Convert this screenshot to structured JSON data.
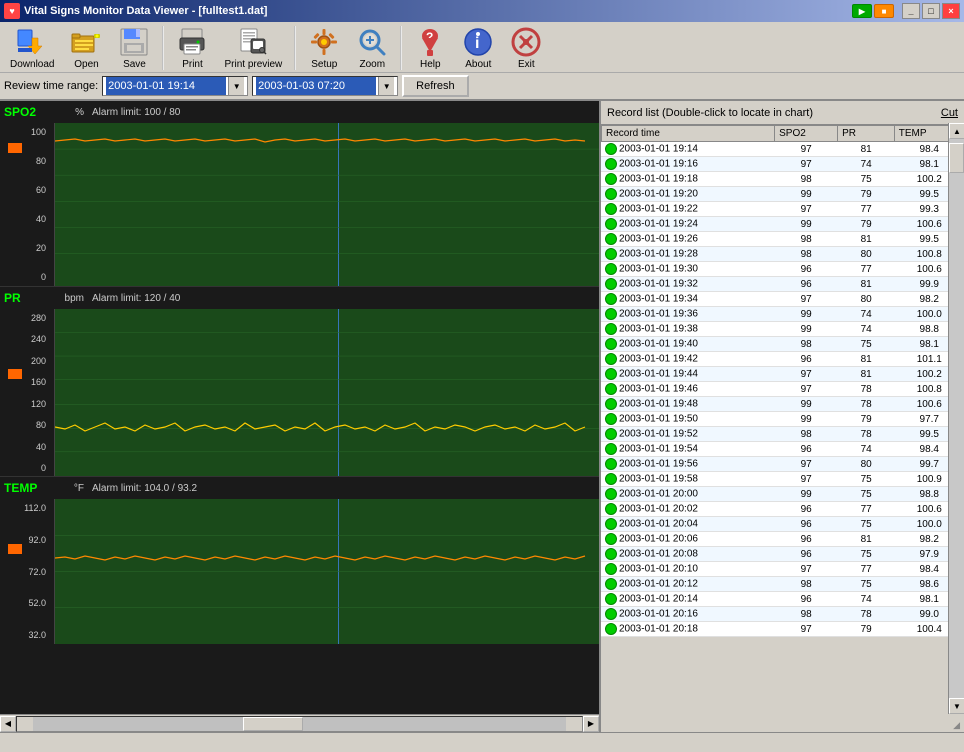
{
  "window": {
    "title": "Vital Signs Monitor Data Viewer - [fulltest1.dat]",
    "icon": "♥"
  },
  "toolbar": {
    "buttons": [
      {
        "id": "download",
        "label": "Download",
        "icon": "⬇"
      },
      {
        "id": "open",
        "label": "Open",
        "icon": "📁"
      },
      {
        "id": "save",
        "label": "Save",
        "icon": "💾"
      },
      {
        "id": "print",
        "label": "Print",
        "icon": "🖨"
      },
      {
        "id": "print-preview",
        "label": "Print preview",
        "icon": "🖨"
      },
      {
        "id": "setup",
        "label": "Setup",
        "icon": "🔧"
      },
      {
        "id": "zoom",
        "label": "Zoom",
        "icon": "🔍"
      },
      {
        "id": "help",
        "label": "Help",
        "icon": "❓"
      },
      {
        "id": "about",
        "label": "About",
        "icon": "ℹ"
      },
      {
        "id": "exit",
        "label": "Exit",
        "icon": "⏻"
      }
    ]
  },
  "review": {
    "label": "Review time range:",
    "start": "2003-01-01 19:14",
    "end": "2003-01-03 07:20",
    "refresh_label": "Refresh"
  },
  "charts": {
    "spo2": {
      "label": "SPO2",
      "unit": "%",
      "alarm": "Alarm limit:  100 / 80",
      "y_ticks": [
        "100",
        "80",
        "60",
        "40",
        "20",
        "0"
      ],
      "color": "#ff8800"
    },
    "pr": {
      "label": "PR",
      "unit": "bpm",
      "alarm": "Alarm limit:  120 / 40",
      "y_ticks": [
        "280",
        "240",
        "200",
        "160",
        "120",
        "80",
        "40",
        "0"
      ],
      "color": "#ffcc00"
    },
    "temp": {
      "label": "TEMP",
      "unit": "°F",
      "alarm": "Alarm limit:  104.0 / 93.2",
      "y_ticks": [
        "112.0",
        "92.0",
        "72.0",
        "52.0",
        "32.0"
      ],
      "color": "#ff8800"
    }
  },
  "record_list": {
    "title": "Record list (Double-click to locate in chart)",
    "cut_label": "Cut",
    "columns": [
      "Record time",
      "SPO2",
      "PR",
      "TEMP"
    ],
    "rows": [
      {
        "time": "2003-01-01 19:14",
        "spo2": "97",
        "pr": "81",
        "temp": "98.4"
      },
      {
        "time": "2003-01-01 19:16",
        "spo2": "97",
        "pr": "74",
        "temp": "98.1"
      },
      {
        "time": "2003-01-01 19:18",
        "spo2": "98",
        "pr": "75",
        "temp": "100.2"
      },
      {
        "time": "2003-01-01 19:20",
        "spo2": "99",
        "pr": "79",
        "temp": "99.5"
      },
      {
        "time": "2003-01-01 19:22",
        "spo2": "97",
        "pr": "77",
        "temp": "99.3"
      },
      {
        "time": "2003-01-01 19:24",
        "spo2": "99",
        "pr": "79",
        "temp": "100.6"
      },
      {
        "time": "2003-01-01 19:26",
        "spo2": "98",
        "pr": "81",
        "temp": "99.5"
      },
      {
        "time": "2003-01-01 19:28",
        "spo2": "98",
        "pr": "80",
        "temp": "100.8"
      },
      {
        "time": "2003-01-01 19:30",
        "spo2": "96",
        "pr": "77",
        "temp": "100.6"
      },
      {
        "time": "2003-01-01 19:32",
        "spo2": "96",
        "pr": "81",
        "temp": "99.9"
      },
      {
        "time": "2003-01-01 19:34",
        "spo2": "97",
        "pr": "80",
        "temp": "98.2"
      },
      {
        "time": "2003-01-01 19:36",
        "spo2": "99",
        "pr": "74",
        "temp": "100.0"
      },
      {
        "time": "2003-01-01 19:38",
        "spo2": "99",
        "pr": "74",
        "temp": "98.8"
      },
      {
        "time": "2003-01-01 19:40",
        "spo2": "98",
        "pr": "75",
        "temp": "98.1"
      },
      {
        "time": "2003-01-01 19:42",
        "spo2": "96",
        "pr": "81",
        "temp": "101.1"
      },
      {
        "time": "2003-01-01 19:44",
        "spo2": "97",
        "pr": "81",
        "temp": "100.2"
      },
      {
        "time": "2003-01-01 19:46",
        "spo2": "97",
        "pr": "78",
        "temp": "100.8"
      },
      {
        "time": "2003-01-01 19:48",
        "spo2": "99",
        "pr": "78",
        "temp": "100.6"
      },
      {
        "time": "2003-01-01 19:50",
        "spo2": "99",
        "pr": "79",
        "temp": "97.7"
      },
      {
        "time": "2003-01-01 19:52",
        "spo2": "98",
        "pr": "78",
        "temp": "99.5"
      },
      {
        "time": "2003-01-01 19:54",
        "spo2": "96",
        "pr": "74",
        "temp": "98.4"
      },
      {
        "time": "2003-01-01 19:56",
        "spo2": "97",
        "pr": "80",
        "temp": "99.7"
      },
      {
        "time": "2003-01-01 19:58",
        "spo2": "97",
        "pr": "75",
        "temp": "100.9"
      },
      {
        "time": "2003-01-01 20:00",
        "spo2": "99",
        "pr": "75",
        "temp": "98.8"
      },
      {
        "time": "2003-01-01 20:02",
        "spo2": "96",
        "pr": "77",
        "temp": "100.6"
      },
      {
        "time": "2003-01-01 20:04",
        "spo2": "96",
        "pr": "75",
        "temp": "100.0"
      },
      {
        "time": "2003-01-01 20:06",
        "spo2": "96",
        "pr": "81",
        "temp": "98.2"
      },
      {
        "time": "2003-01-01 20:08",
        "spo2": "96",
        "pr": "75",
        "temp": "97.9"
      },
      {
        "time": "2003-01-01 20:10",
        "spo2": "97",
        "pr": "77",
        "temp": "98.4"
      },
      {
        "time": "2003-01-01 20:12",
        "spo2": "98",
        "pr": "75",
        "temp": "98.6"
      },
      {
        "time": "2003-01-01 20:14",
        "spo2": "96",
        "pr": "74",
        "temp": "98.1"
      },
      {
        "time": "2003-01-01 20:16",
        "spo2": "98",
        "pr": "78",
        "temp": "99.0"
      },
      {
        "time": "2003-01-01 20:18",
        "spo2": "97",
        "pr": "79",
        "temp": "100.4"
      }
    ]
  },
  "statusbar": {
    "text": ""
  },
  "titlebar": {
    "controls": {
      "minimize": "_",
      "maximize": "□",
      "close": "×"
    }
  }
}
